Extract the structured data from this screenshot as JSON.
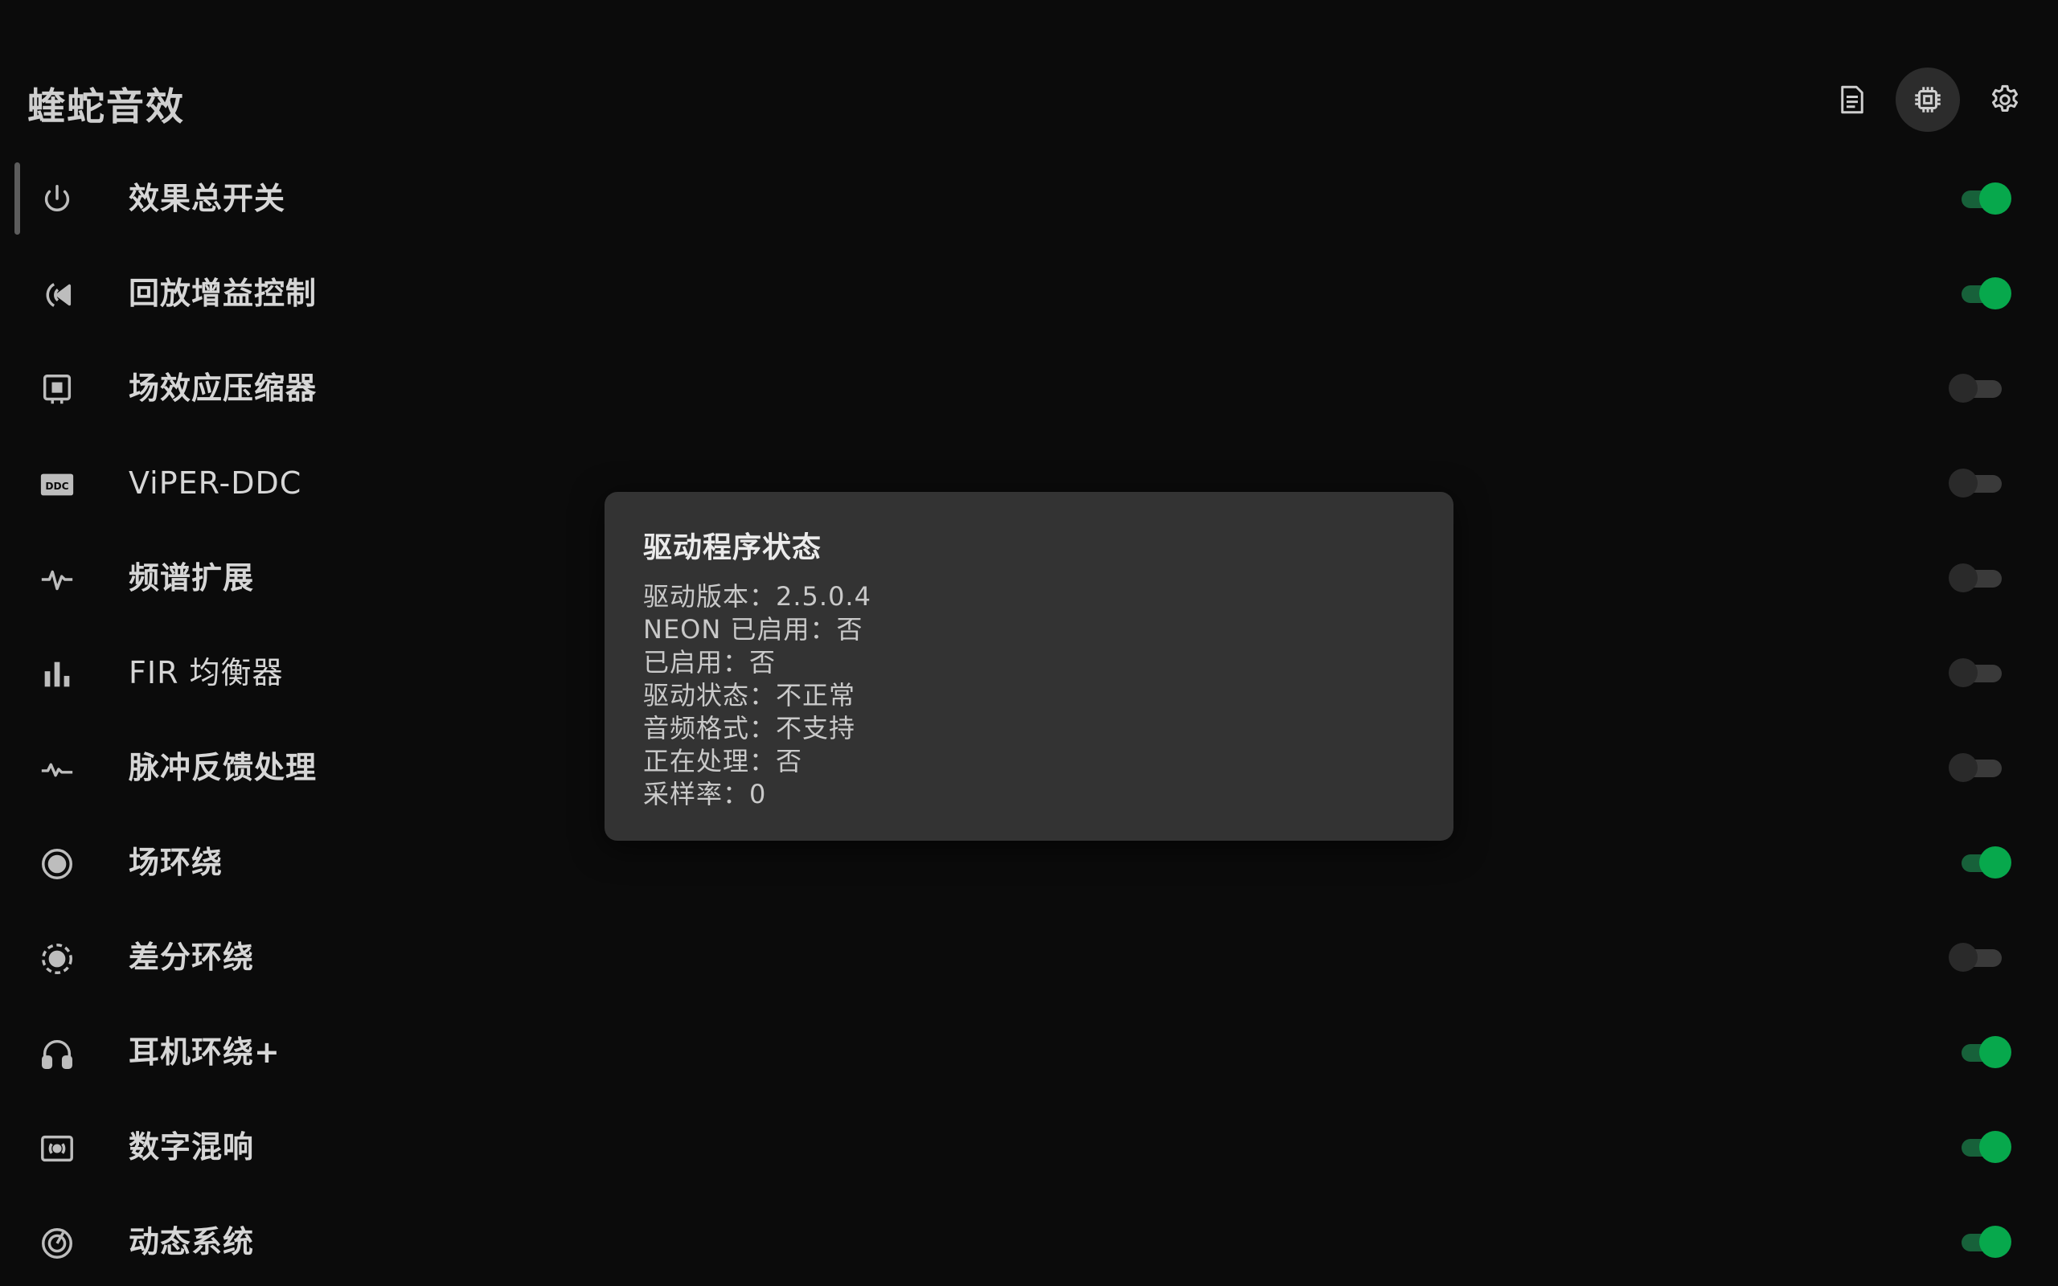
{
  "app": {
    "title": "蝰蛇音效"
  },
  "toolbar": {
    "log_icon": "document-icon",
    "driver_icon": "chip-icon",
    "settings_icon": "gear-icon"
  },
  "effects": [
    {
      "label": "效果总开关",
      "icon": "power-icon",
      "on": true,
      "selected": true
    },
    {
      "label": "回放增益控制",
      "icon": "playback-gain-icon",
      "on": true
    },
    {
      "label": "场效应压缩器",
      "icon": "compressor-icon",
      "on": false
    },
    {
      "label": "ViPER-DDC",
      "icon": "ddc-icon",
      "on": false
    },
    {
      "label": "频谱扩展",
      "icon": "pulse-icon",
      "on": false
    },
    {
      "label": "FIR 均衡器",
      "icon": "bars-icon",
      "on": false
    },
    {
      "label": "脉冲反馈处理",
      "icon": "wave-icon",
      "on": false
    },
    {
      "label": "场环绕",
      "icon": "radio-button-icon",
      "on": true
    },
    {
      "label": "差分环绕",
      "icon": "dashed-circle-icon",
      "on": false
    },
    {
      "label": "耳机环绕+",
      "icon": "headphones-icon",
      "on": true
    },
    {
      "label": "数字混响",
      "icon": "speaker-box-icon",
      "on": true
    },
    {
      "label": "动态系统",
      "icon": "target-icon",
      "on": true
    }
  ],
  "dialog": {
    "title": "驱动程序状态",
    "lines": [
      "驱动版本：2.5.0.4",
      "NEON 已启用：否",
      "已启用：否",
      "驱动状态：不正常",
      "音频格式：不支持",
      "正在处理：否",
      "采样率：0"
    ]
  },
  "colors": {
    "background": "#0b0b0b",
    "accent": "#07a84c",
    "dialog": "#333333"
  }
}
